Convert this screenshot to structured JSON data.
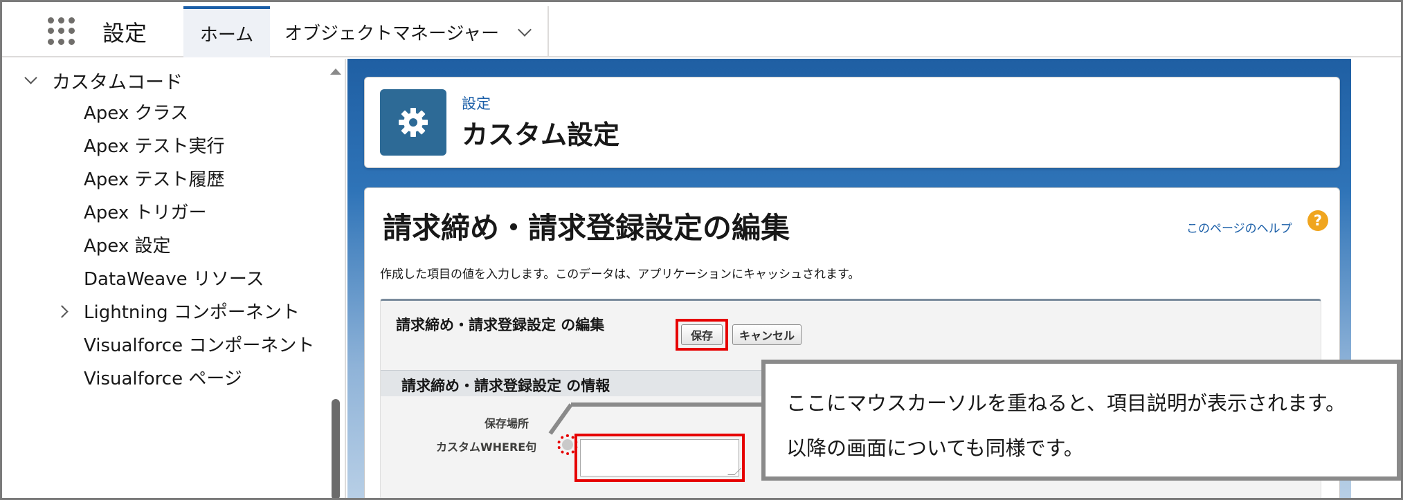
{
  "topnav": {
    "app_name": "設定",
    "tabs": [
      {
        "label": "ホーム"
      },
      {
        "label": "オブジェクトマネージャー"
      }
    ]
  },
  "sidebar": {
    "section_label": "カスタムコード",
    "items": [
      {
        "label": "Apex クラス"
      },
      {
        "label": "Apex テスト実行"
      },
      {
        "label": "Apex テスト履歴"
      },
      {
        "label": "Apex トリガー"
      },
      {
        "label": "Apex 設定"
      },
      {
        "label": "DataWeave リソース"
      },
      {
        "label": "Lightning コンポーネント"
      },
      {
        "label": "Visualforce コンポーネント"
      },
      {
        "label": "Visualforce ページ"
      }
    ]
  },
  "header": {
    "eyebrow": "設定",
    "title": "カスタム設定",
    "icon": "gear-icon"
  },
  "content": {
    "page_title": "請求締め・請求登録設定の編集",
    "help_link": "このページのヘルプ",
    "help_icon_glyph": "?",
    "description": "作成した項目の値を入力します。このデータは、アプリケーションにキャッシュされます。",
    "edit_block": {
      "title": "請求締め・請求登録設定 の編集",
      "save_label": "保存",
      "cancel_label": "キャンセル",
      "section_title": "請求締め・請求登録設定 の情報",
      "field_label_1": "保存場所",
      "field_label_2": "カスタムWHERE句",
      "field_value": ""
    }
  },
  "callout": {
    "line1": "ここにマウスカーソルを重ねると、項目説明が表示されます。",
    "line2": "以降の画面についても同様です。"
  },
  "colors": {
    "accent": "#1b5fa8",
    "highlight": "#e60000",
    "setup_icon_bg": "#2d6a96",
    "help_icon_bg": "#f0a51f"
  }
}
